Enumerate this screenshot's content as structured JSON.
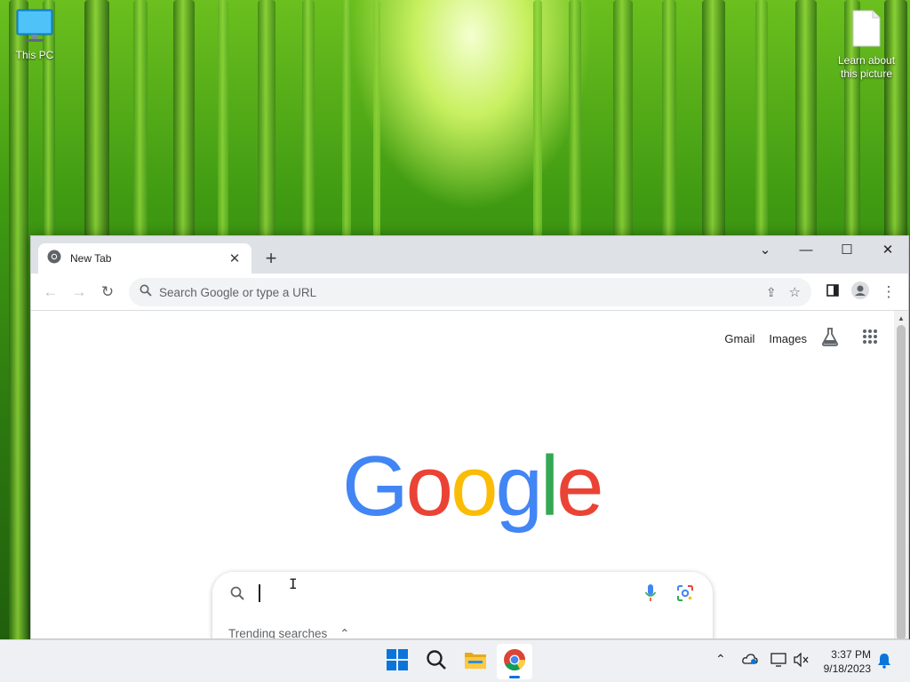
{
  "desktop": {
    "icons": [
      {
        "label": "This PC",
        "icon": "monitor-icon"
      },
      {
        "label": "Learn about this picture",
        "icon": "document-icon"
      }
    ]
  },
  "browser": {
    "tab": {
      "title": "New Tab",
      "icon": "chrome-icon"
    },
    "window_controls": [
      "tab-search",
      "minimize",
      "maximize",
      "close"
    ],
    "omnibox": {
      "placeholder": "Search Google or type a URL"
    },
    "page": {
      "top_links": {
        "gmail": "Gmail",
        "images": "Images"
      },
      "logo": {
        "text": "Google",
        "letters": [
          {
            "ch": "G",
            "color": "#4285F4"
          },
          {
            "ch": "o",
            "color": "#EA4335"
          },
          {
            "ch": "o",
            "color": "#FBBC05"
          },
          {
            "ch": "g",
            "color": "#4285F4"
          },
          {
            "ch": "l",
            "color": "#34A853"
          },
          {
            "ch": "e",
            "color": "#EA4335"
          }
        ]
      },
      "search": {
        "value": "",
        "trending_label": "Trending searches"
      }
    }
  },
  "taskbar": {
    "apps": [
      "start-icon",
      "search-icon",
      "file-explorer-icon",
      "chrome-icon"
    ],
    "clock": {
      "time": "3:37 PM",
      "date": "9/18/2023"
    }
  }
}
